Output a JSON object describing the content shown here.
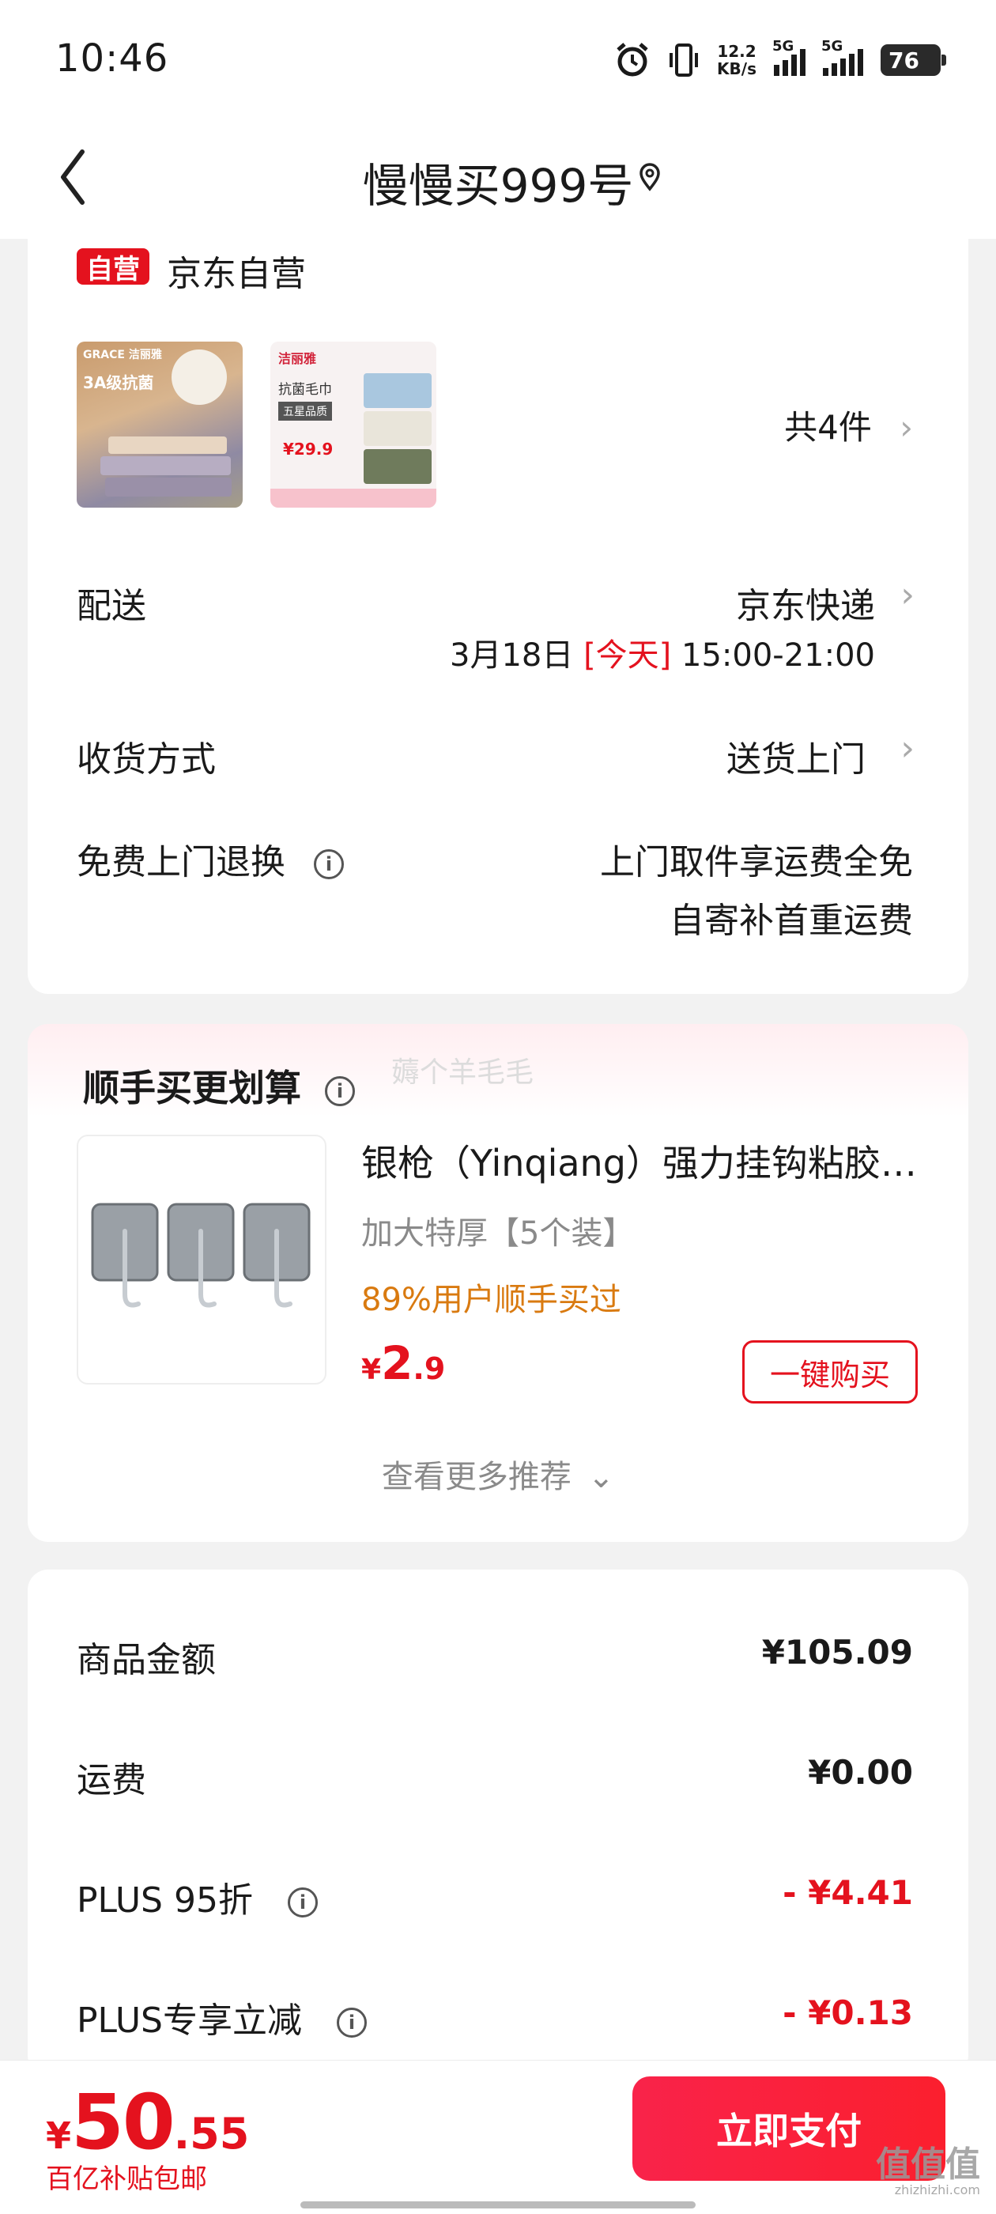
{
  "status_bar": {
    "time": "10:46",
    "speed_value": "12.2",
    "speed_unit": "KB/s",
    "net1": "5G",
    "net2": "5G",
    "battery": "76"
  },
  "nav": {
    "back_icon": "chevron-left-icon",
    "title": "慢慢买999号",
    "location_icon": "location-pin-icon"
  },
  "order": {
    "shop_badge": "自营",
    "shop_name": "京东自营",
    "items_count": "共4件",
    "thumb2_brand": "洁丽雅",
    "thumb2_tag": "抗菌毛巾",
    "thumb2_badge": "五星品质",
    "thumb2_price": "¥29.9",
    "thumb1_brand": "GRACE 洁丽雅",
    "thumb1_tag": "3A级抗菌",
    "delivery_label": "配送",
    "delivery_value": "京东快递",
    "delivery_date": "3月18日",
    "delivery_today": "[今天]",
    "delivery_time": "15:00-21:00",
    "receive_label": "收货方式",
    "receive_value": "送货上门",
    "return_label": "免费上门退换",
    "return_line1": "上门取件享运费全免",
    "return_line2": "自寄补首重运费"
  },
  "recommend": {
    "title": "顺手买更划算",
    "ghost_text": "薅个羊毛毛",
    "product_name": "银枪（Yinqiang）强力挂钩粘胶…",
    "product_spec": "加大特厚【5个装】",
    "product_tag": "89%用户顺手买过",
    "price_symbol": "¥",
    "price_int": "2",
    "price_dec": ".9",
    "buy_button": "一键购买",
    "more": "查看更多推荐"
  },
  "summary": {
    "rows": [
      {
        "label": "商品金额",
        "value": "¥105.09",
        "discount": false,
        "info": false
      },
      {
        "label": "运费",
        "value": "¥0.00",
        "discount": false,
        "info": false
      },
      {
        "label": "PLUS 95折",
        "value": "- ¥4.41",
        "discount": true,
        "info": true
      },
      {
        "label": "PLUS专享立减",
        "value": "- ¥0.13",
        "discount": true,
        "info": true
      }
    ]
  },
  "bottom": {
    "price_symbol": "¥",
    "price_int": "50",
    "price_dec": ".55",
    "subsidy": "百亿补贴包邮",
    "pay_button": "立即支付"
  },
  "watermark": {
    "text": "值值值",
    "domain": "zhizhizhi.com"
  },
  "colors": {
    "accent": "#e4121e",
    "tag_orange": "#d97a10",
    "background": "#f2f2f2"
  }
}
